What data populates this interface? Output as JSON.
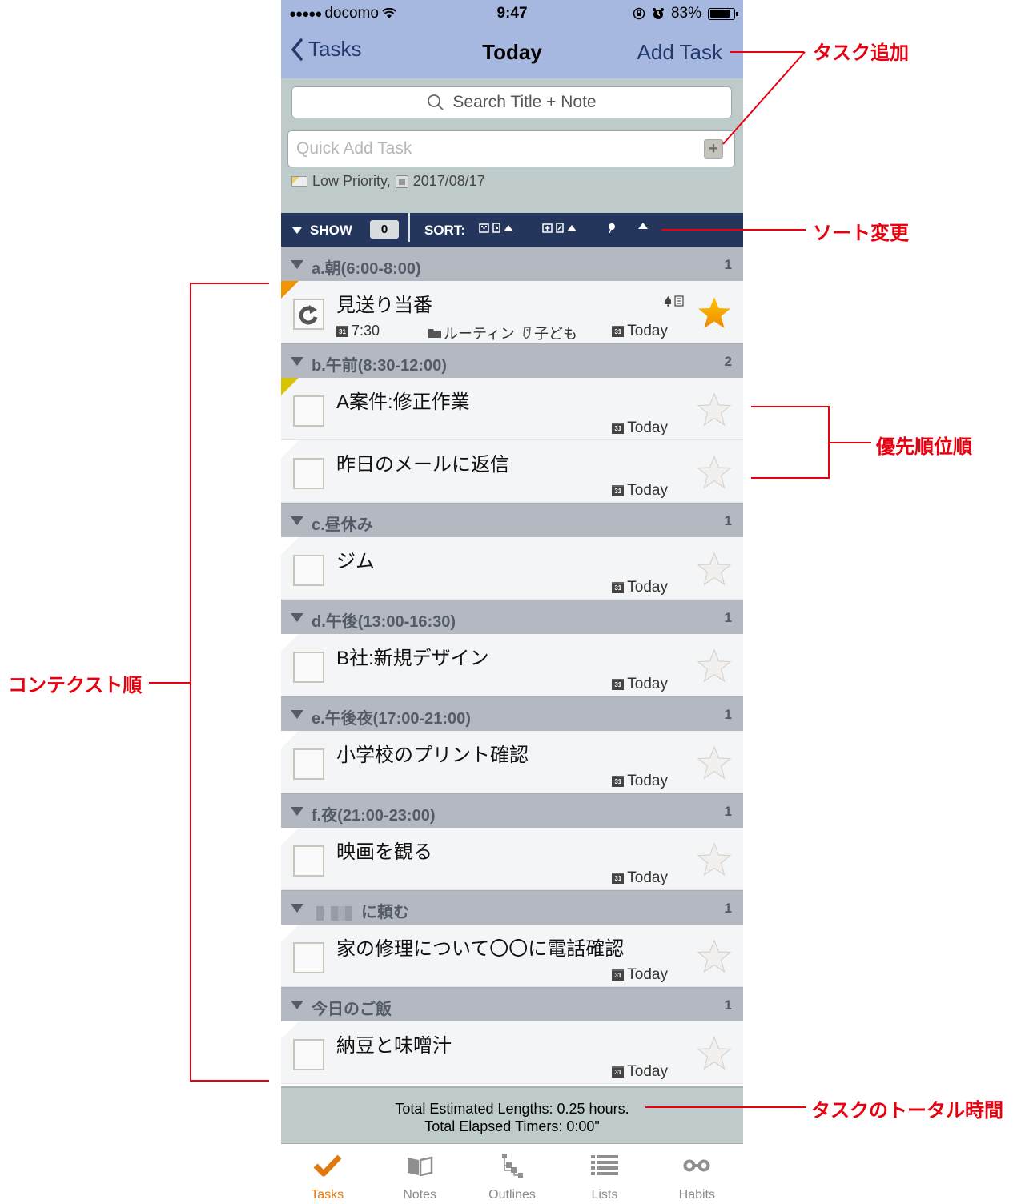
{
  "status_bar": {
    "carrier": "docomo",
    "signal_dots": "●●●●●",
    "time": "9:47",
    "battery_percent": "83%",
    "battery_level": 0.83
  },
  "nav": {
    "back_label": "Tasks",
    "title": "Today",
    "add_label": "Add Task"
  },
  "search": {
    "placeholder": "Search Title + Note"
  },
  "quick_add": {
    "placeholder": "Quick Add Task",
    "value": "",
    "add_button": "+",
    "default_priority": "Low Priority,",
    "default_date": "2017/08/17"
  },
  "toolbar": {
    "show_label": "SHOW",
    "show_count": "0",
    "sort_label": "SORT:"
  },
  "groups": [
    {
      "name": "a.朝(6:00-8:00)",
      "count": "1",
      "tasks": [
        {
          "title": "見送り当番",
          "flag": "high",
          "repeat": true,
          "starred": true,
          "time": "7:30",
          "folder": "ルーティン",
          "tag": "子ども",
          "due": "Today"
        }
      ]
    },
    {
      "name": "b.午前(8:30-12:00)",
      "count": "2",
      "tasks": [
        {
          "title": "A案件:修正作業",
          "flag": "med",
          "starred": false,
          "due": "Today"
        },
        {
          "title": "昨日のメールに返信",
          "flag": "none",
          "starred": false,
          "due": "Today"
        }
      ]
    },
    {
      "name": "c.昼休み",
      "count": "1",
      "tasks": [
        {
          "title": "ジム",
          "flag": "none",
          "starred": false,
          "due": "Today"
        }
      ]
    },
    {
      "name": "d.午後(13:00-16:30)",
      "count": "1",
      "tasks": [
        {
          "title": "B社:新規デザイン",
          "flag": "none",
          "starred": false,
          "due": "Today"
        }
      ]
    },
    {
      "name": "e.午後夜(17:00-21:00)",
      "count": "1",
      "tasks": [
        {
          "title": "小学校のプリント確認",
          "flag": "none",
          "starred": false,
          "due": "Today"
        }
      ]
    },
    {
      "name": "f.夜(21:00-23:00)",
      "count": "1",
      "tasks": [
        {
          "title": "映画を観る",
          "flag": "none",
          "starred": false,
          "due": "Today"
        }
      ]
    },
    {
      "name": "に頼む",
      "name_blurred_prefix": true,
      "count": "1",
      "tasks": [
        {
          "title": "家の修理について〇〇に電話確認",
          "flag": "none",
          "starred": false,
          "due": "Today"
        }
      ]
    },
    {
      "name": "今日のご飯",
      "count": "1",
      "tasks": [
        {
          "title": "納豆と味噌汁",
          "flag": "none",
          "starred": false,
          "due": "Today"
        }
      ]
    }
  ],
  "summary": {
    "line1": "Total Estimated Lengths: 0.25 hours.",
    "line2": "Total Elapsed Timers: 0:00\""
  },
  "tabbar": {
    "items": [
      {
        "label": "Tasks",
        "icon": "checkmark-icon",
        "active": true
      },
      {
        "label": "Notes",
        "icon": "book-icon",
        "active": false
      },
      {
        "label": "Outlines",
        "icon": "outline-tree-icon",
        "active": false
      },
      {
        "label": "Lists",
        "icon": "list-icon",
        "active": false
      },
      {
        "label": "Habits",
        "icon": "chain-link-icon",
        "active": false
      }
    ]
  },
  "annotations": {
    "add_task": "タスク追加",
    "sort_change": "ソート変更",
    "priority_order": "優先順位順",
    "context_order": "コンテクスト順",
    "total_time": "タスクのトータル時間"
  },
  "colors": {
    "nav_bg": "#a6b8e0",
    "toolbar_bg": "#24365c",
    "group_bg": "#b3b8c1",
    "accent_orange": "#e07a10",
    "annotation_red": "#e8000e"
  }
}
